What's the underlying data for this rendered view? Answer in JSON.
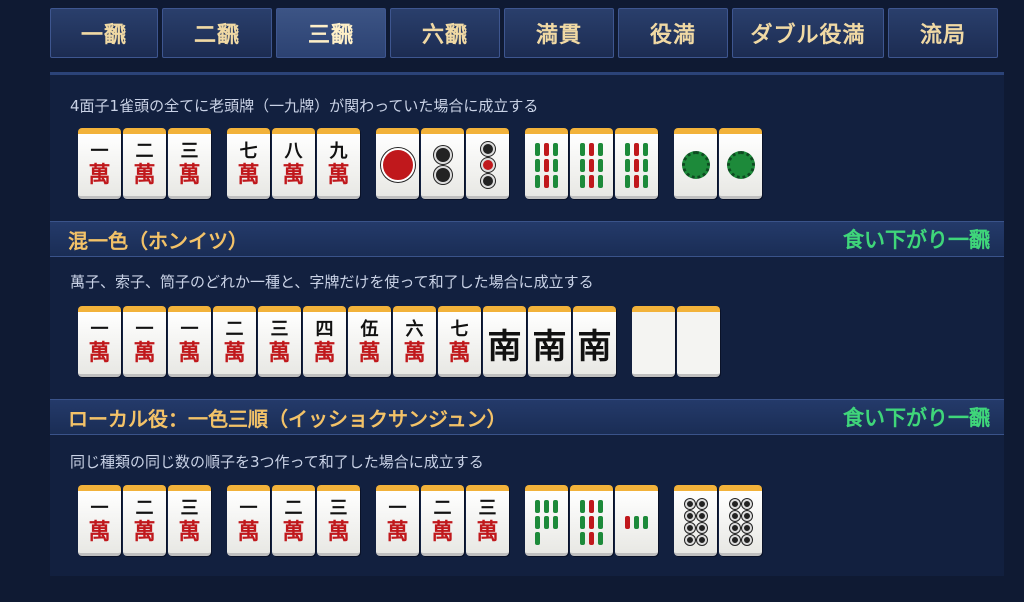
{
  "tabs": [
    {
      "label": "一飜",
      "width": 108,
      "active": false
    },
    {
      "label": "二飜",
      "width": 110,
      "active": false
    },
    {
      "label": "三飜",
      "width": 110,
      "active": true
    },
    {
      "label": "六飜",
      "width": 110,
      "active": false
    },
    {
      "label": "満貫",
      "width": 110,
      "active": false
    },
    {
      "label": "役満",
      "width": 110,
      "active": false
    },
    {
      "label": "ダブル役満",
      "width": 152,
      "active": false
    },
    {
      "label": "流局",
      "width": 110,
      "active": false
    }
  ],
  "sections": [
    {
      "title": "",
      "note": "",
      "description": "4面子1雀頭の全てに老頭牌（一九牌）が関わっていた場合に成立する"
    },
    {
      "title": "混一色（ホンイツ）",
      "note": "食い下がり一飜",
      "description": "萬子、索子、筒子のどれか一種と、字牌だけを使って和了した場合に成立する"
    },
    {
      "title": "ローカル役：一色三順（イッショクサンジュン）",
      "note": "食い下がり一飜",
      "description": "同じ種類の同じ数の順子を3つ作って和了した場合に成立する"
    }
  ],
  "tile_text": {
    "man": "萬",
    "nums": [
      "一",
      "二",
      "三",
      "四",
      "伍",
      "六",
      "七",
      "八",
      "九"
    ],
    "south": "南"
  }
}
